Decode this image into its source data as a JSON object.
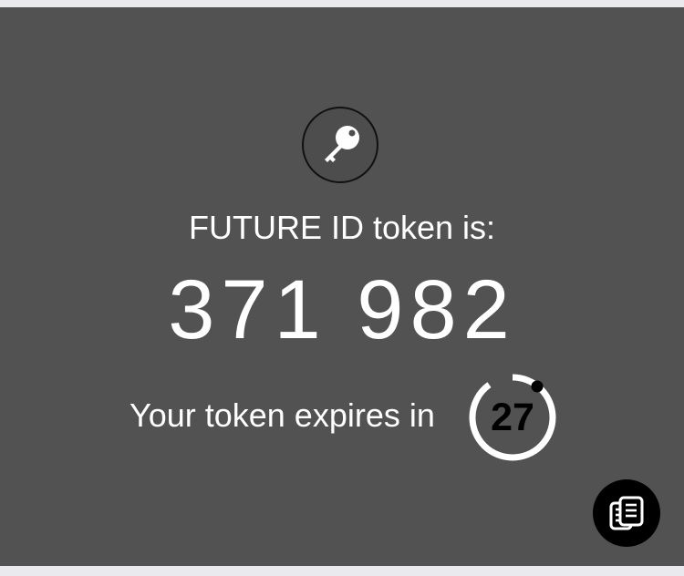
{
  "token_screen": {
    "title": "FUTURE ID token is:",
    "token": "371 982",
    "expiry_label": "Your token expires in",
    "seconds_remaining": "27",
    "countdown_fraction_remaining": 0.9
  },
  "icons": {
    "badge": "key-icon",
    "action": "copy-icon"
  },
  "colors": {
    "panel_background": "#525252",
    "text": "#ffffff",
    "timer_ring": "#ffffff",
    "copy_button_background": "#000000"
  }
}
